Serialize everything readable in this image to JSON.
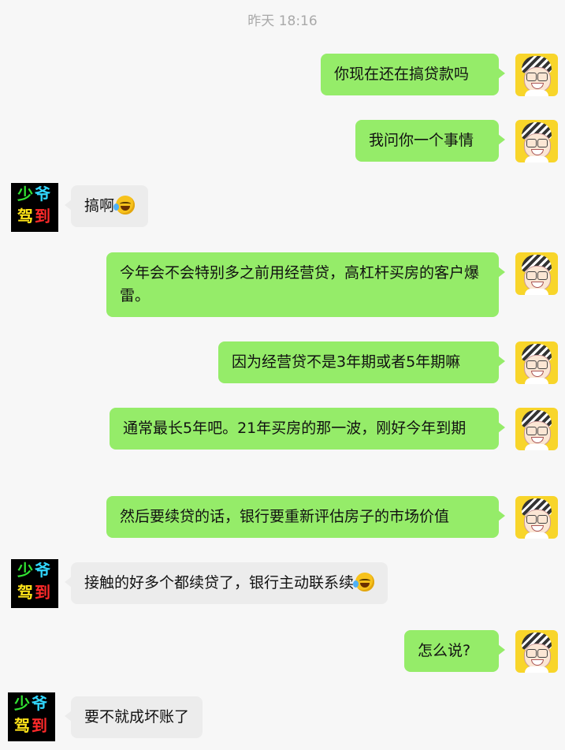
{
  "chat": {
    "timestamp": "昨天 18:16",
    "messages": [
      {
        "side": "right",
        "text": "你现在还在搞贷款吗"
      },
      {
        "side": "right",
        "text": "我问你一个事情"
      },
      {
        "side": "left",
        "text": "搞啊",
        "emoji": "laugh-cry-emoji"
      },
      {
        "side": "right",
        "text": "今年会不会特别多之前用经营贷，高杠杆买房的客户爆雷。"
      },
      {
        "side": "right",
        "text": "因为经营贷不是3年期或者5年期嘛"
      },
      {
        "side": "right",
        "text": "通常最长5年吧。21年买房的那一波，刚好今年到期"
      },
      {
        "side": "right",
        "text": "然后要续贷的话，银行要重新评估房子的市场价值"
      },
      {
        "side": "left",
        "text": "接触的好多个都续贷了，银行主动联系续",
        "emoji": "laugh-cry-emoji"
      },
      {
        "side": "right",
        "text": "怎么说?"
      },
      {
        "side": "left",
        "text": "要不就成坏账了"
      }
    ]
  },
  "avatars": {
    "other": {
      "line1_a": "少",
      "line1_b": "爷",
      "line2_a": "驾",
      "line2_b": "到"
    }
  },
  "colors": {
    "right_bubble": "#95ec69",
    "left_bubble": "#ececec",
    "background": "#f7f7f7"
  }
}
